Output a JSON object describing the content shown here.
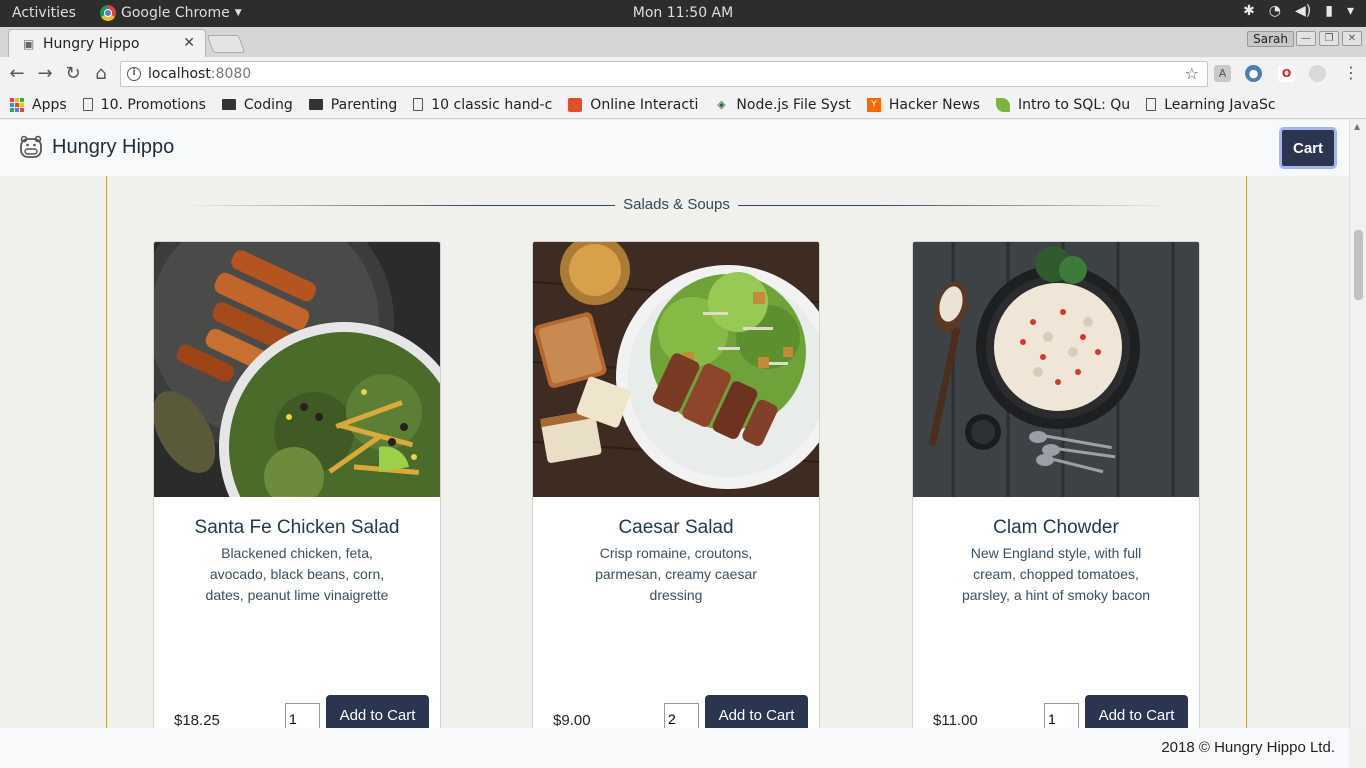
{
  "system_bar": {
    "activities": "Activities",
    "app_name": "Google Chrome",
    "clock": "Mon 11:50 AM"
  },
  "browser": {
    "tab_title": "Hungry Hippo",
    "profile_name": "Sarah",
    "url_host": "localhost",
    "url_port": ":8080",
    "bookmarks": [
      {
        "label": "Apps",
        "icon": "apps-grid-icon"
      },
      {
        "label": "10. Promotions",
        "icon": "document-icon"
      },
      {
        "label": "Coding",
        "icon": "folder-icon"
      },
      {
        "label": "Parenting",
        "icon": "folder-icon"
      },
      {
        "label": "10 classic hand-c",
        "icon": "document-icon"
      },
      {
        "label": "Online Interacti",
        "icon": "html5-icon"
      },
      {
        "label": "Node.js File Syst",
        "icon": "nodejs-icon"
      },
      {
        "label": "Hacker News",
        "icon": "ycombinator-icon"
      },
      {
        "label": "Intro to SQL: Qu",
        "icon": "leaf-icon"
      },
      {
        "label": "Learning JavaSc",
        "icon": "document-icon"
      }
    ]
  },
  "app": {
    "brand": "Hungry Hippo",
    "cart_label": "Cart",
    "section_title": "Salads & Soups",
    "add_label": "Add to Cart",
    "items": [
      {
        "title": "Santa Fe Chicken Salad",
        "description": "Blackened chicken, feta, avocado, black beans, corn, dates, peanut lime vinaigrette",
        "price": "$18.25",
        "quantity": "1"
      },
      {
        "title": "Caesar Salad",
        "description": "Crisp romaine, croutons, parmesan, creamy caesar dressing",
        "price": "$9.00",
        "quantity": "2"
      },
      {
        "title": "Clam Chowder",
        "description": "New England style, with full cream, chopped tomatoes, parsley, a hint of smoky bacon",
        "price": "$11.00",
        "quantity": "1"
      }
    ],
    "footer": "2018 © Hungry Hippo Ltd."
  },
  "colors": {
    "primary_button": "#2b3550",
    "accent_border": "#c4a04c",
    "page_background": "#f0f1ec",
    "heading_text": "#1f3a4d"
  }
}
